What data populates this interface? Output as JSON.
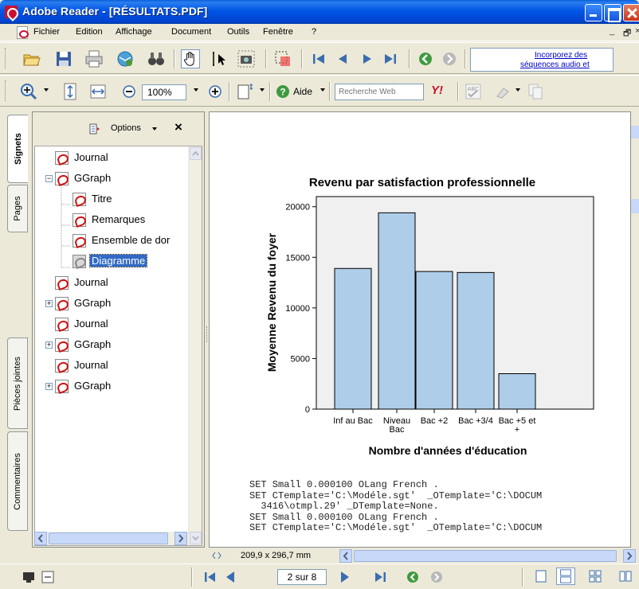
{
  "window": {
    "title": "Adobe Reader - [RÉSULTATS.PDF]"
  },
  "menubar": {
    "items": [
      "Fichier",
      "Edition",
      "Affichage",
      "Document",
      "Outils",
      "Fenêtre",
      "?"
    ],
    "mdi_controls": [
      "_",
      "🗗",
      "×"
    ]
  },
  "toolbar1": {
    "icons": [
      "open-icon",
      "save-icon",
      "print-icon",
      "email-icon",
      "search-icon",
      "hand-tool-icon",
      "select-text-icon",
      "snapshot-icon",
      "crop-icon",
      "first-page-icon",
      "previous-page-icon",
      "next-page-icon",
      "last-page-icon",
      "previous-view-icon",
      "next-view-icon"
    ],
    "promo_line1": "Incorporez des",
    "promo_line2": "séquences audio et"
  },
  "toolbar2": {
    "zoom_value": "100%",
    "help_label": "Aide",
    "search_placeholder": "Recherche Web",
    "yahoo_label": "Y!"
  },
  "nav_tabs": [
    "Signets",
    "Pages",
    "Pièces jointes",
    "Commentaires"
  ],
  "bookmarks": {
    "options_label": "Options",
    "close": "×",
    "items": [
      {
        "label": "Journal",
        "level": 0,
        "expand": "",
        "selected": false
      },
      {
        "label": "GGraph",
        "level": 0,
        "expand": "−",
        "selected": false
      },
      {
        "label": "Titre",
        "level": 1,
        "expand": "",
        "selected": false
      },
      {
        "label": "Remarques",
        "level": 1,
        "expand": "",
        "selected": false
      },
      {
        "label": "Ensemble de dor",
        "level": 1,
        "expand": "",
        "selected": false
      },
      {
        "label": "Diagramme",
        "level": 1,
        "expand": "",
        "selected": true
      },
      {
        "label": "Journal",
        "level": 0,
        "expand": "",
        "selected": false
      },
      {
        "label": "GGraph",
        "level": 0,
        "expand": "+",
        "selected": false
      },
      {
        "label": "Journal",
        "level": 0,
        "expand": "",
        "selected": false
      },
      {
        "label": "GGraph",
        "level": 0,
        "expand": "+",
        "selected": false
      },
      {
        "label": "Journal",
        "level": 0,
        "expand": "",
        "selected": false
      },
      {
        "label": "GGraph",
        "level": 0,
        "expand": "+",
        "selected": false
      }
    ]
  },
  "chart_data": {
    "type": "bar",
    "title": "Revenu par satisfaction professionnelle",
    "xlabel": "Nombre d'années d'éducation",
    "ylabel": "Moyenne Revenu du foyer",
    "categories": [
      "Inf au Bac",
      "Niveau Bac",
      "Bac +2",
      "Bac +3/4",
      "Bac +5 et +"
    ],
    "category_lines": [
      [
        "Inf au Bac"
      ],
      [
        "Niveau",
        "Bac"
      ],
      [
        "Bac +2"
      ],
      [
        "Bac +3/4"
      ],
      [
        "Bac +5 et",
        "+"
      ]
    ],
    "values": [
      13900,
      19400,
      13600,
      13500,
      3500
    ],
    "ylim": [
      0,
      21000
    ],
    "yticks": [
      "0",
      "5000",
      "10000",
      "15000",
      "20000"
    ],
    "bar_color": "#aecde8",
    "plot_bg": "#f0f0f0",
    "grid": false
  },
  "syntax_lines": [
    "SET Small 0.000100 OLang French .",
    "SET CTemplate='C:\\Modéle.sgt'  _OTemplate='C:\\DOCUM",
    "  3416\\otmpl.29' _DTemplate=None.",
    "SET Small 0.000100 OLang French .",
    "SET CTemplate='C:\\Modéle.sgt'  _OTemplate='C:\\DOCUM"
  ],
  "page_size": "209,9 x 296,7 mm",
  "status": {
    "page_indicator": "2 sur 8"
  },
  "colors": {
    "titlebar_blue": "#0055e5",
    "selection_blue": "#316ac5",
    "link_blue": "#0000cc"
  }
}
